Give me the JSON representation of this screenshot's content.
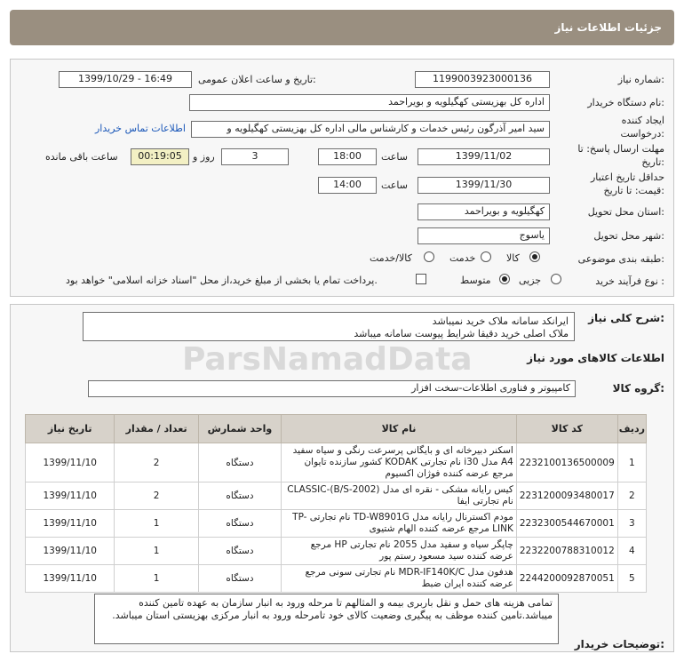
{
  "header": {
    "title": "جزئیات اطلاعات نیاز"
  },
  "fields": {
    "need_number": {
      "label": "شماره نیاز:",
      "value": "1199003923000136"
    },
    "announce": {
      "label": "تاریخ و ساعت اعلان عمومی:",
      "value": "1399/10/29 - 16:49"
    },
    "buyer_org": {
      "label": "نام دستگاه خریدار:",
      "value": "اداره کل بهزیستی کهگیلویه و بویراحمد"
    },
    "creator": {
      "label": "ایجاد کننده درخواست:",
      "value": "سید امیر آذرگون رئیس خدمات و کارشناس مالی اداره کل بهزیستی کهگیلویه و"
    },
    "contact_link": "اطلاعات تماس خریدار",
    "reply_deadline": {
      "label": "مهلت ارسال پاسخ: تا تاریخ:",
      "date": "1399/11/02",
      "time_label": "ساعت",
      "time": "18:00",
      "days": "3",
      "days_label": "روز و",
      "remaining": "00:19:05",
      "remaining_label": "ساعت باقی مانده"
    },
    "price_validity": {
      "label": "حداقل تاریخ اعتبار قیمت: تا تاریخ:",
      "date": "1399/11/30",
      "time_label": "ساعت",
      "time": "14:00"
    },
    "delivery_province": {
      "label": "استان محل تحویل:",
      "value": "کهگیلویه و بویراحمد"
    },
    "delivery_city": {
      "label": "شهر محل تحویل:",
      "value": "یاسوج"
    },
    "category": {
      "label": "طبقه بندی موضوعی:",
      "options": [
        "کالا",
        "خدمت",
        "کالا/خدمت"
      ],
      "selected": "کالا"
    },
    "process": {
      "label": "نوع فرآیند خرید :",
      "options": [
        "جزیی",
        "متوسط"
      ],
      "selected": "متوسط",
      "payment_note": "پرداخت تمام یا بخشی از مبلغ خرید،از محل \"اسناد خزانه اسلامی\" خواهد بود."
    }
  },
  "description": {
    "label": "شرح کلی نیاز:",
    "lines": [
      "ایرانکد سامانه ملاک خرید نمیباشد",
      "ملاک اصلی خرید  دقیقا شرایط پیوست سامانه میباشد"
    ]
  },
  "goods_section_title": "اطلاعات کالاهای مورد نیاز",
  "goods_group": {
    "label": "گروه کالا:",
    "value": "کامپیوتر و فناوری اطلاعات-سخت افزار"
  },
  "table": {
    "headers": [
      "ردیف",
      "کد کالا",
      "نام کالا",
      "واحد شمارش",
      "تعداد / مقدار",
      "تاریخ نیاز"
    ],
    "rows": [
      {
        "row": "1",
        "code": "2232100136500009",
        "name": "اسکنر دبیرخانه ای و بایگانی پرسرعت رنگی و سیاه سفید A4 مدل i30 نام تجارتی KODAK کشور سازنده تایوان مرجع عرضه کننده فوژان اکسیوم",
        "unit": "دستگاه",
        "qty": "2",
        "date": "1399/11/10"
      },
      {
        "row": "2",
        "code": "2231200093480017",
        "name": "کیس رایانه مشکی - نقره ای مدل CLASSIC-(B/S-2002) نام تجارتی ایفا",
        "unit": "دستگاه",
        "qty": "2",
        "date": "1399/11/10"
      },
      {
        "row": "3",
        "code": "2232300544670001",
        "name": "مودم اکسترنال رایانه مدل TD-W8901G نام تجارتی TP-LINK مرجع عرضه کننده الهام شتیوی",
        "unit": "دستگاه",
        "qty": "1",
        "date": "1399/11/10"
      },
      {
        "row": "4",
        "code": "2232200788310012",
        "name": "چاپگر سیاه و سفید مدل 2055 نام تجارتی HP مرجع عرضه کننده سید مسعود رستم پور",
        "unit": "دستگاه",
        "qty": "1",
        "date": "1399/11/10"
      },
      {
        "row": "5",
        "code": "2244200092870051",
        "name": "هدفون مدل MDR-IF140K/C نام تجارتی سونی مرجع عرضه کننده ایران ضبط",
        "unit": "دستگاه",
        "qty": "1",
        "date": "1399/11/10"
      }
    ]
  },
  "buyer_notes": {
    "label": "توضیحات خریدار:",
    "text": "تمامی هزینه های حمل و نقل باربری بیمه و المثالهم تا مرحله ورود به انبار سازمان به عهده تامین کننده میباشد.تامین کننده موظف به پیگیری  وضعیت کالای خود تامرحله ورود به انبار مرکزی بهزیستی استان میباشد."
  },
  "watermark": "ParsNamadData"
}
